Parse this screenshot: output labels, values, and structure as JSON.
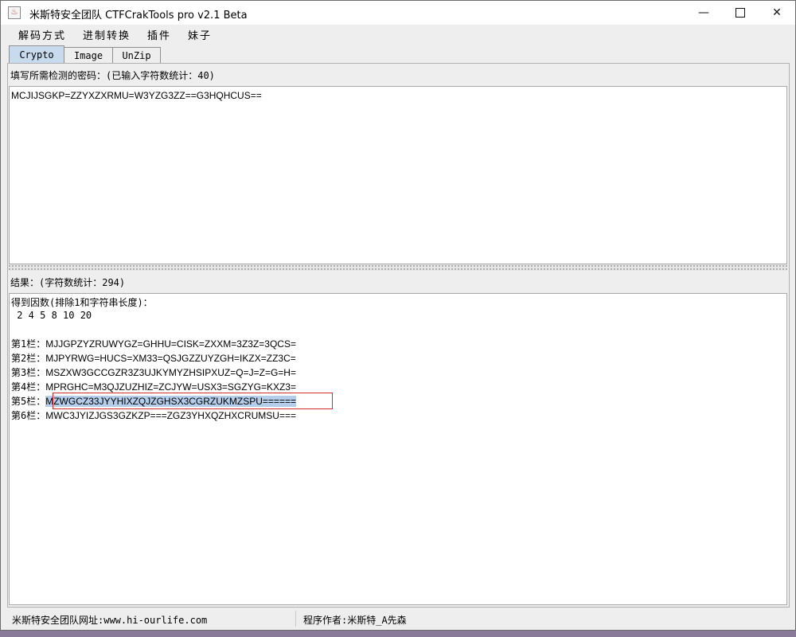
{
  "window": {
    "title": "米斯特安全团队 CTFCrakTools pro v2.1 Beta",
    "app_icon": "java-cup-icon",
    "minimize_glyph": "—",
    "close_glyph": "✕"
  },
  "menu": {
    "items": [
      "解码方式",
      "进制转换",
      "插件",
      "妹子"
    ]
  },
  "tabs": [
    {
      "label": "Crypto",
      "active": true
    },
    {
      "label": "Image",
      "active": false
    },
    {
      "label": "UnZip",
      "active": false
    }
  ],
  "input": {
    "label": "填写所需检测的密码：(已输入字符数统计：40)",
    "value": "MCJIJSGKP=ZZYXZXRMU=W3YZG3ZZ==G3HQHCUS=="
  },
  "result": {
    "label": "结果：(字符数统计：294)",
    "lines": [
      {
        "prefix": "得到因数(排除1和字符串长度)：",
        "value": ""
      },
      {
        "prefix": " 2 4 5 8 10 20",
        "value": ""
      },
      {
        "prefix": "",
        "value": ""
      },
      {
        "prefix": "第1栏：",
        "value": "MJJGPZYZRUWYGZ=GHHU=CISK=ZXXM=3Z3Z=3QCS="
      },
      {
        "prefix": "第2栏：",
        "value": "MJPYRWG=HUCS=XM33=QSJGZZUYZGH=IKZX=ZZ3C="
      },
      {
        "prefix": "第3栏：",
        "value": "MSZXW3GCCGZR3Z3UJKYMYZHSIPXUZ=Q=J=Z=G=H="
      },
      {
        "prefix": "第4栏：",
        "value": "MPRGHC=M3QJZUZHIZ=ZCJYW=USX3=SGZYG=KXZ3="
      },
      {
        "prefix": "第5栏：",
        "value": "MZWGCZ33JYYHIXZQJZGHSX3CGRZUKMZSPU======"
      },
      {
        "prefix": "第6栏：",
        "value": "MWC3JYIZJGS3GZKZP===ZGZ3YHXQZHXCRUMSU==="
      }
    ],
    "selected_line_index": 7
  },
  "status": {
    "left": "米斯特安全团队网址:www.hi-ourlife.com",
    "right": "程序作者:米斯特_A先森"
  }
}
